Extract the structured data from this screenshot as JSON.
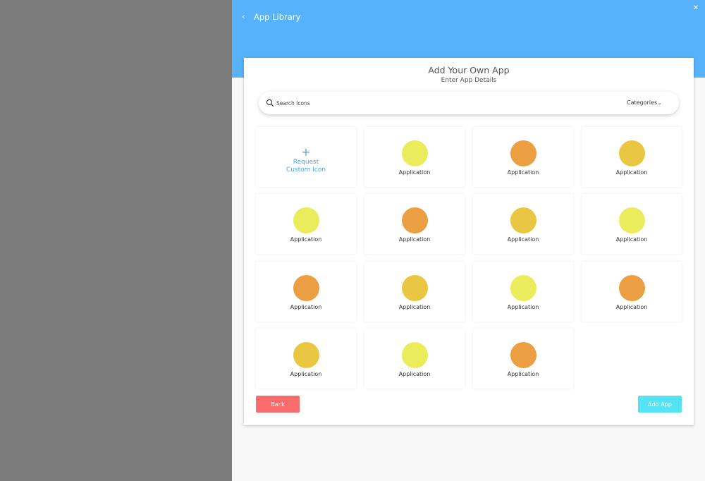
{
  "header": {
    "title": "App Library",
    "back_icon": "chevron-left-icon",
    "close_icon": "close-icon",
    "color": "#56b2fb"
  },
  "card": {
    "title": "Add Your Own App",
    "subtitle": "Enter App Details"
  },
  "search": {
    "placeholder": "Search Icons",
    "categories_label": "Categories"
  },
  "request_tile": {
    "plus": "+",
    "label_line1": "Request",
    "label_line2": "Custom Icon",
    "color": "#4aa8e4"
  },
  "apps": [
    {
      "label": "Application",
      "color": "#eaec5c"
    },
    {
      "label": "Application",
      "color": "#eb9e42"
    },
    {
      "label": "Application",
      "color": "#eac743"
    },
    {
      "label": "Application",
      "color": "#eaec5c"
    },
    {
      "label": "Application",
      "color": "#eb9e42"
    },
    {
      "label": "Application",
      "color": "#eac743"
    },
    {
      "label": "Application",
      "color": "#eaec5c"
    },
    {
      "label": "Application",
      "color": "#eb9e42"
    },
    {
      "label": "Application",
      "color": "#eac743"
    },
    {
      "label": "Application",
      "color": "#eaec5c"
    },
    {
      "label": "Application",
      "color": "#eb9e42"
    },
    {
      "label": "Application",
      "color": "#eac743"
    },
    {
      "label": "Application",
      "color": "#eaec5c"
    },
    {
      "label": "Application",
      "color": "#eb9e42"
    }
  ],
  "buttons": {
    "back": "Back",
    "add": "Add App",
    "back_color": "#fa6b6b",
    "add_color": "#55e2f2"
  }
}
